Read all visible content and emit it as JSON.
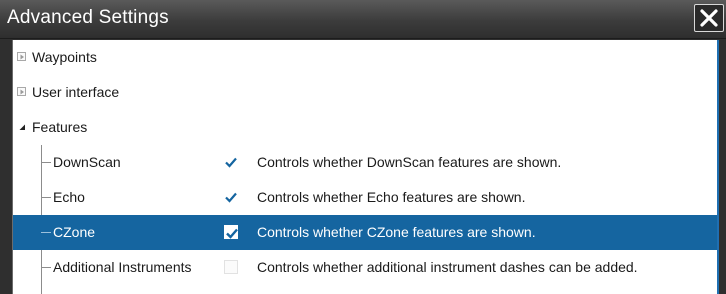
{
  "window": {
    "title": "Advanced Settings"
  },
  "tree": {
    "groups": [
      {
        "label": "Waypoints",
        "expanded": false
      },
      {
        "label": "User interface",
        "expanded": false
      },
      {
        "label": "Features",
        "expanded": true
      }
    ],
    "features": [
      {
        "label": "DownScan",
        "checked": true,
        "description": "Controls whether DownScan features are shown.",
        "selected": false
      },
      {
        "label": "Echo",
        "checked": true,
        "description": "Controls whether Echo features are shown.",
        "selected": false
      },
      {
        "label": "CZone",
        "checked": true,
        "description": "Controls whether CZone features are shown.",
        "selected": true
      },
      {
        "label": "Additional Instruments",
        "checked": false,
        "description": "Controls whether additional instrument dashes can be added.",
        "selected": false
      }
    ]
  },
  "icons": {
    "close": "close-icon",
    "collapsed": "triangle-right-icon",
    "expanded": "triangle-down-icon",
    "check": "checkmark-icon"
  },
  "colors": {
    "selection": "#1565a0",
    "check": "#1565a0",
    "titlebar": "#3c3c3c"
  }
}
